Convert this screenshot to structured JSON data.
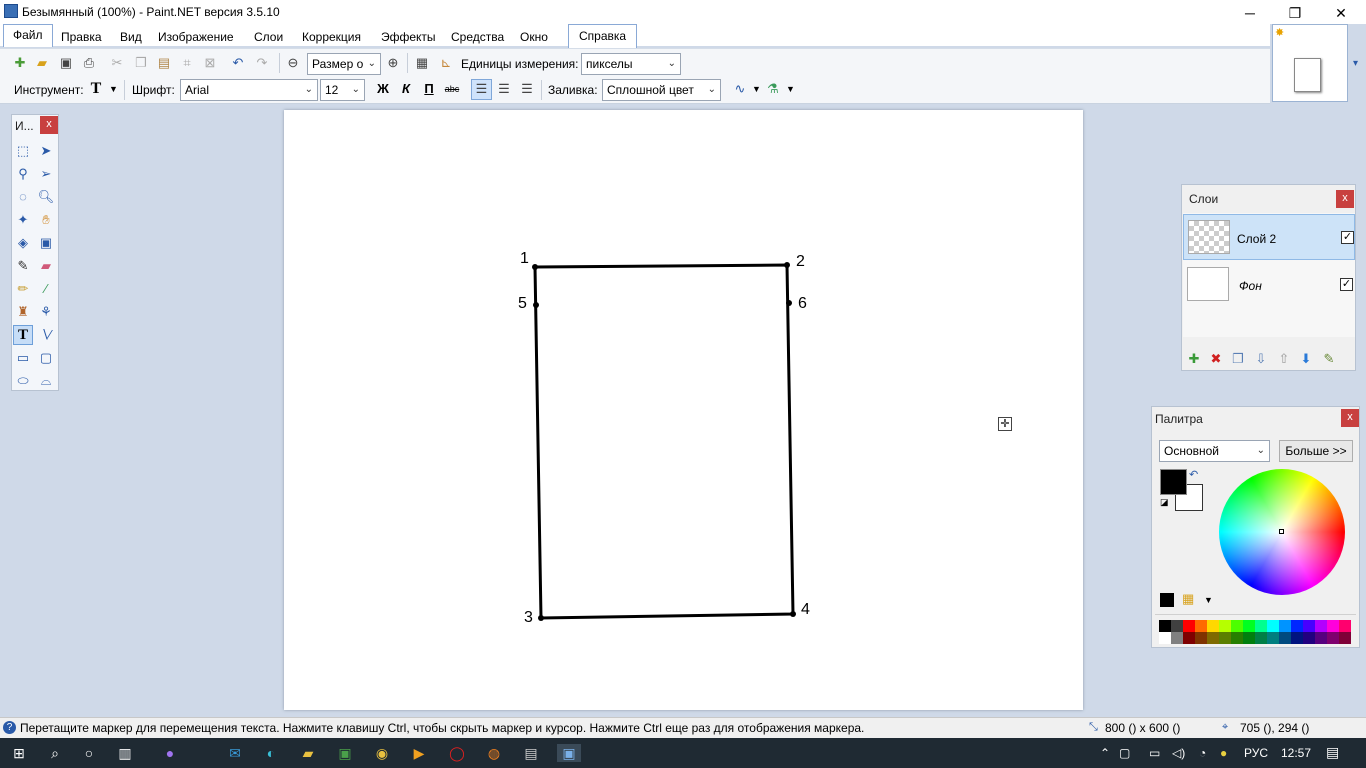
{
  "window": {
    "title": "Безымянный (100%) - Paint.NET версия 3.5.10",
    "minimize_glyph": "─",
    "restore_glyph": "❐",
    "close_glyph": "✕"
  },
  "menu": [
    "Файл",
    "Правка",
    "Вид",
    "Изображение",
    "Слои",
    "Коррекция",
    "Эффекты",
    "Средства",
    "Окно",
    "Справка"
  ],
  "toolbar1": {
    "zoom_combo": "Размер о",
    "units_label": "Единицы измерения:",
    "units_value": "пикселы"
  },
  "toolbar2": {
    "tool_label": "Инструмент:",
    "font_label": "Шрифт:",
    "font_value": "Arial",
    "size_value": "12",
    "bold": "Ж",
    "italic": "К",
    "underline": "П",
    "strike": "abc",
    "fill_label": "Заливка:",
    "fill_value": "Сплошной цвет"
  },
  "tools_panel": {
    "title": "И...",
    "close": "x"
  },
  "layers_panel": {
    "title": "Слои",
    "close": "x",
    "layers": [
      {
        "name": "Слой 2",
        "checked": "✓"
      },
      {
        "name": "Фон",
        "checked": "✓"
      }
    ]
  },
  "palette_panel": {
    "title": "Палитра",
    "close": "x",
    "mode_value": "Основной",
    "more_button": "Больше >>"
  },
  "drawing": {
    "points": [
      {
        "label": "1"
      },
      {
        "label": "2"
      },
      {
        "label": "3"
      },
      {
        "label": "4"
      },
      {
        "label": "5"
      },
      {
        "label": "6"
      }
    ]
  },
  "status": {
    "message": "Перетащите маркер для перемещения текста. Нажмите клавишу Ctrl, чтобы скрыть маркер и курсор. Нажмите Ctrl еще раз для отображения маркера.",
    "image_size": "800 () x 600 ()",
    "cursor_pos": "705 (), 294 ()"
  },
  "taskbar": {
    "lang": "РУС",
    "time": "12:57"
  },
  "colors": {
    "primary": "#000000",
    "secondary": "#ffffff",
    "palette_row1": [
      "#000000",
      "#404040",
      "#ff0000",
      "#ff6a00",
      "#ffd800",
      "#b6ff00",
      "#4cff00",
      "#00ff21",
      "#00ff90",
      "#00ffff",
      "#0094ff",
      "#0026ff",
      "#4800ff",
      "#b200ff",
      "#ff00dc",
      "#ff006e"
    ],
    "palette_row2": [
      "#ffffff",
      "#808080",
      "#7f0000",
      "#7f3300",
      "#7f6a00",
      "#5b7f00",
      "#267f00",
      "#007f0e",
      "#007f46",
      "#007f7f",
      "#004a7f",
      "#00137f",
      "#21007f",
      "#57007f",
      "#7f006e",
      "#7f0037"
    ]
  }
}
